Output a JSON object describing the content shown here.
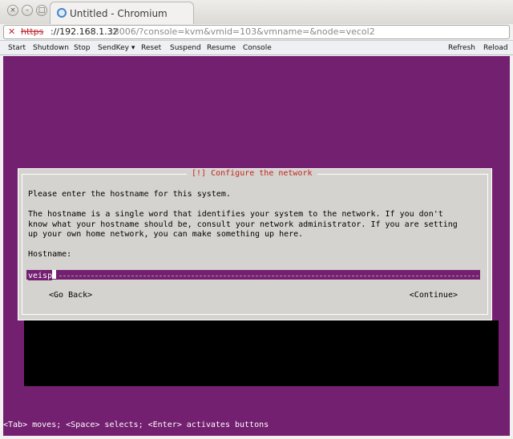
{
  "window": {
    "tab_title": "Untitled - Chromium"
  },
  "address": {
    "scheme": "https",
    "host": "://192.168.1.32",
    "rest": ":8006/?console=kvm&vmid=103&vmname=&node=vecol2"
  },
  "toolbar": {
    "start": "Start",
    "shutdown": "Shutdown",
    "stop": "Stop",
    "sendkey": "SendKey ▾",
    "reset": "Reset",
    "suspend": "Suspend",
    "resume": "Resume",
    "console": "Console",
    "refresh": "Refresh",
    "reload": "Reload"
  },
  "dialog": {
    "title": "[!] Configure the network",
    "prompt": "Please enter the hostname for this system.",
    "description": "The hostname is a single word that identifies your system to the network. If you don't\nknow what your hostname should be, consult your network administrator. If you are setting\nup your own home network, you can make something up here.",
    "hostname_label": "Hostname:",
    "hostname_value": "veisp",
    "go_back": "<Go Back>",
    "continue": "<Continue>"
  },
  "helpline": "<Tab> moves; <Space> selects; <Enter> activates buttons",
  "colors": {
    "console_background": "#742070",
    "dialog_background": "#d5d3d0",
    "title_text": "#c02818"
  }
}
